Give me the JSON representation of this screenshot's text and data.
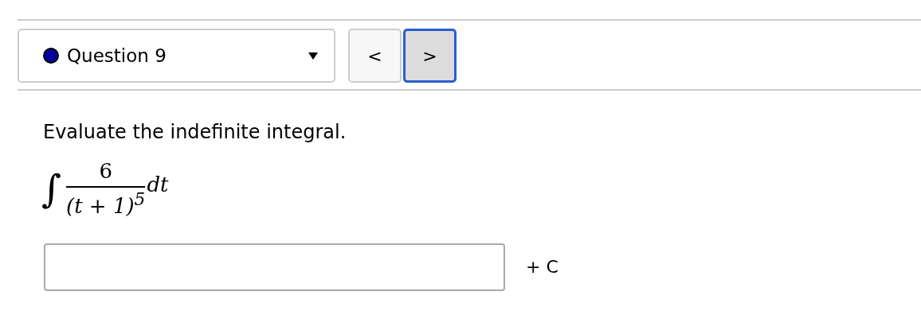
{
  "question_select": {
    "label": "Question 9",
    "color": "#0000a0"
  },
  "nav_buttons": [
    {
      "label": "<",
      "focused": false
    },
    {
      "label": ">",
      "focused": true
    }
  ],
  "prompt": "Evaluate the indefinite integral.",
  "integral": {
    "sign": "∫",
    "numerator": "6",
    "denominator": "(t + 1)$^{5}$",
    "differential": "dt"
  },
  "answer": {
    "suffix": "+ C"
  }
}
